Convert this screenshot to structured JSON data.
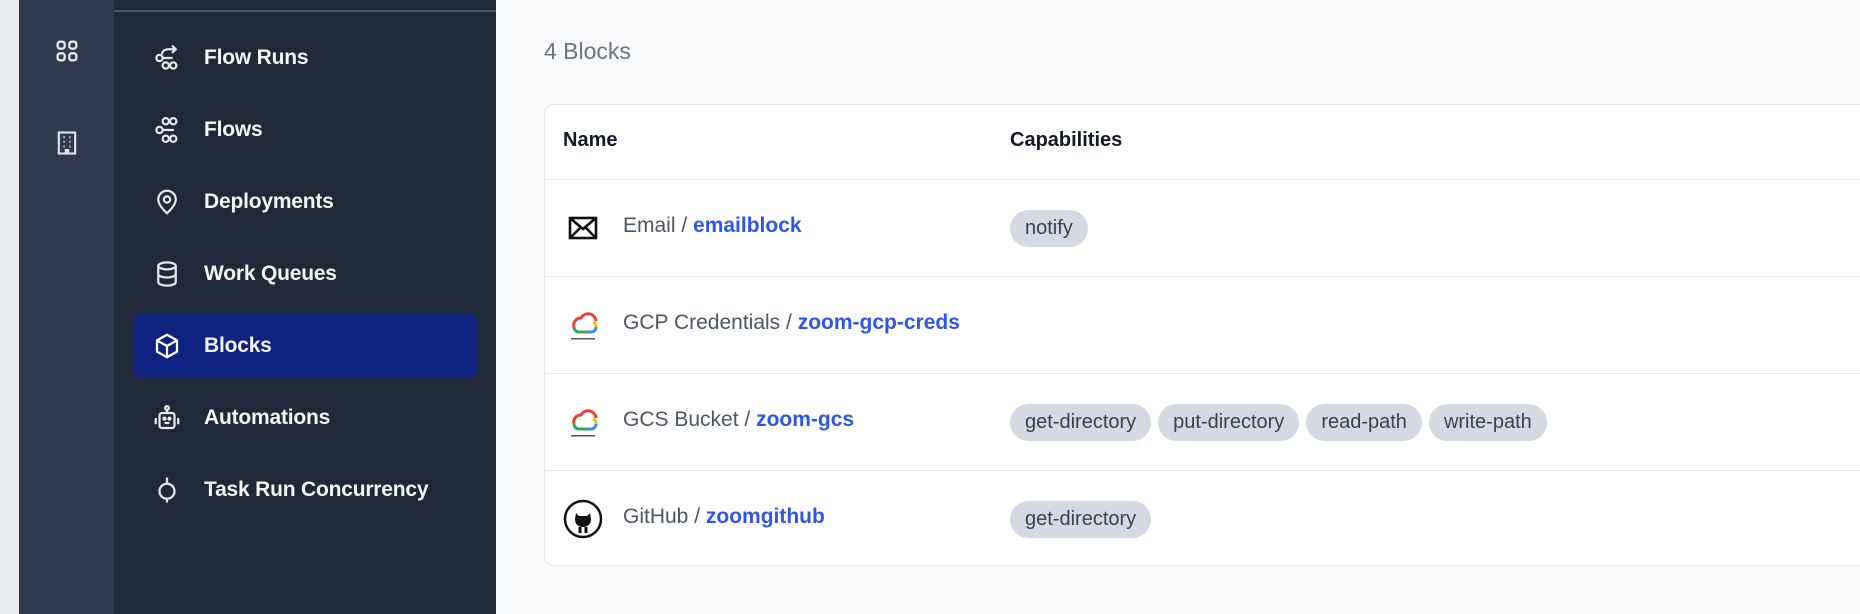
{
  "rail": {
    "icons": [
      {
        "name": "dashboard-grid-icon"
      },
      {
        "name": "building-icon"
      }
    ]
  },
  "sidebar": {
    "items": [
      {
        "label": "Flow Runs",
        "icon": "flow-runs-icon",
        "active": false
      },
      {
        "label": "Flows",
        "icon": "flows-icon",
        "active": false
      },
      {
        "label": "Deployments",
        "icon": "location-pin-icon",
        "active": false
      },
      {
        "label": "Work Queues",
        "icon": "database-icon",
        "active": false
      },
      {
        "label": "Blocks",
        "icon": "cube-icon",
        "active": true
      },
      {
        "label": "Automations",
        "icon": "robot-icon",
        "active": false
      },
      {
        "label": "Task Run Concurrency",
        "icon": "concurrency-icon",
        "active": false
      }
    ]
  },
  "main": {
    "blocks_count": "4 Blocks",
    "table": {
      "headers": {
        "name": "Name",
        "capabilities": "Capabilities"
      },
      "rows": [
        {
          "type": "Email",
          "separator": " / ",
          "name": "emailblock",
          "icon": "envelope-icon",
          "capabilities": [
            "notify"
          ]
        },
        {
          "type": "GCP Credentials",
          "separator": " / ",
          "name": "zoom-gcp-creds",
          "icon": "google-cloud-icon",
          "capabilities": []
        },
        {
          "type": "GCS Bucket",
          "separator": " / ",
          "name": "zoom-gcs",
          "icon": "google-cloud-icon",
          "capabilities": [
            "get-directory",
            "put-directory",
            "read-path",
            "write-path"
          ]
        },
        {
          "type": "GitHub",
          "separator": " / ",
          "name": "zoomgithub",
          "icon": "github-icon",
          "capabilities": [
            "get-directory"
          ]
        }
      ]
    }
  },
  "colors": {
    "sidebar_bg": "#1f2937",
    "active_bg": "#10227f",
    "link": "#2f56ea",
    "badge_bg": "#d5dae2"
  }
}
